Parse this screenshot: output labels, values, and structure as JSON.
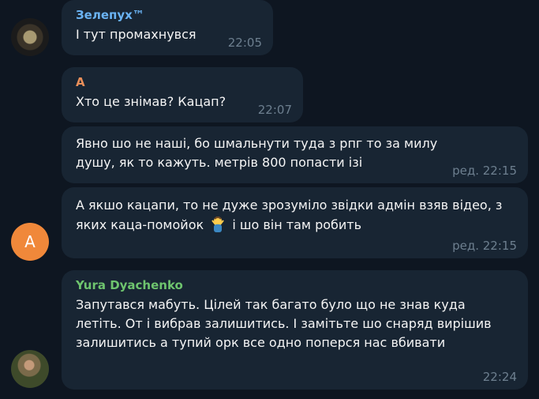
{
  "messages": [
    {
      "sender": "Зелепух™",
      "sender_color": "#6ab3f3",
      "text": "І тут промахнувся",
      "time": "22:05"
    },
    {
      "sender": "A",
      "sender_color": "#e98f5a",
      "text": "Хто це знімав? Кацап?",
      "time": "22:07"
    },
    {
      "sender": "",
      "text": "Явно шо не наші, бо шмальнути туда з рпг то за милу душу, як то кажуть. метрів 800 попасти ізі",
      "time": "ред. 22:15"
    },
    {
      "sender": "",
      "text_before_emoji": "А якшо кацапи, то не дуже зрозуміло звідки адмін взяв відео, з яких каца-помойок",
      "emoji": "person-shrugging-emoji",
      "text_after_emoji": " і шо він там робить",
      "time": "ред. 22:15"
    },
    {
      "sender": "Yura Dyachenko",
      "sender_color": "#6ec46e",
      "text": "Запутався мабуть. Цілей так багато було що не знав куда летіть. От і вибрав залишитись. І замітьте шо снаряд вирішив залишитись а тупий орк все одно поперся нас вбивати",
      "time": "22:24"
    }
  ],
  "avatars": {
    "a_letter": "A"
  }
}
